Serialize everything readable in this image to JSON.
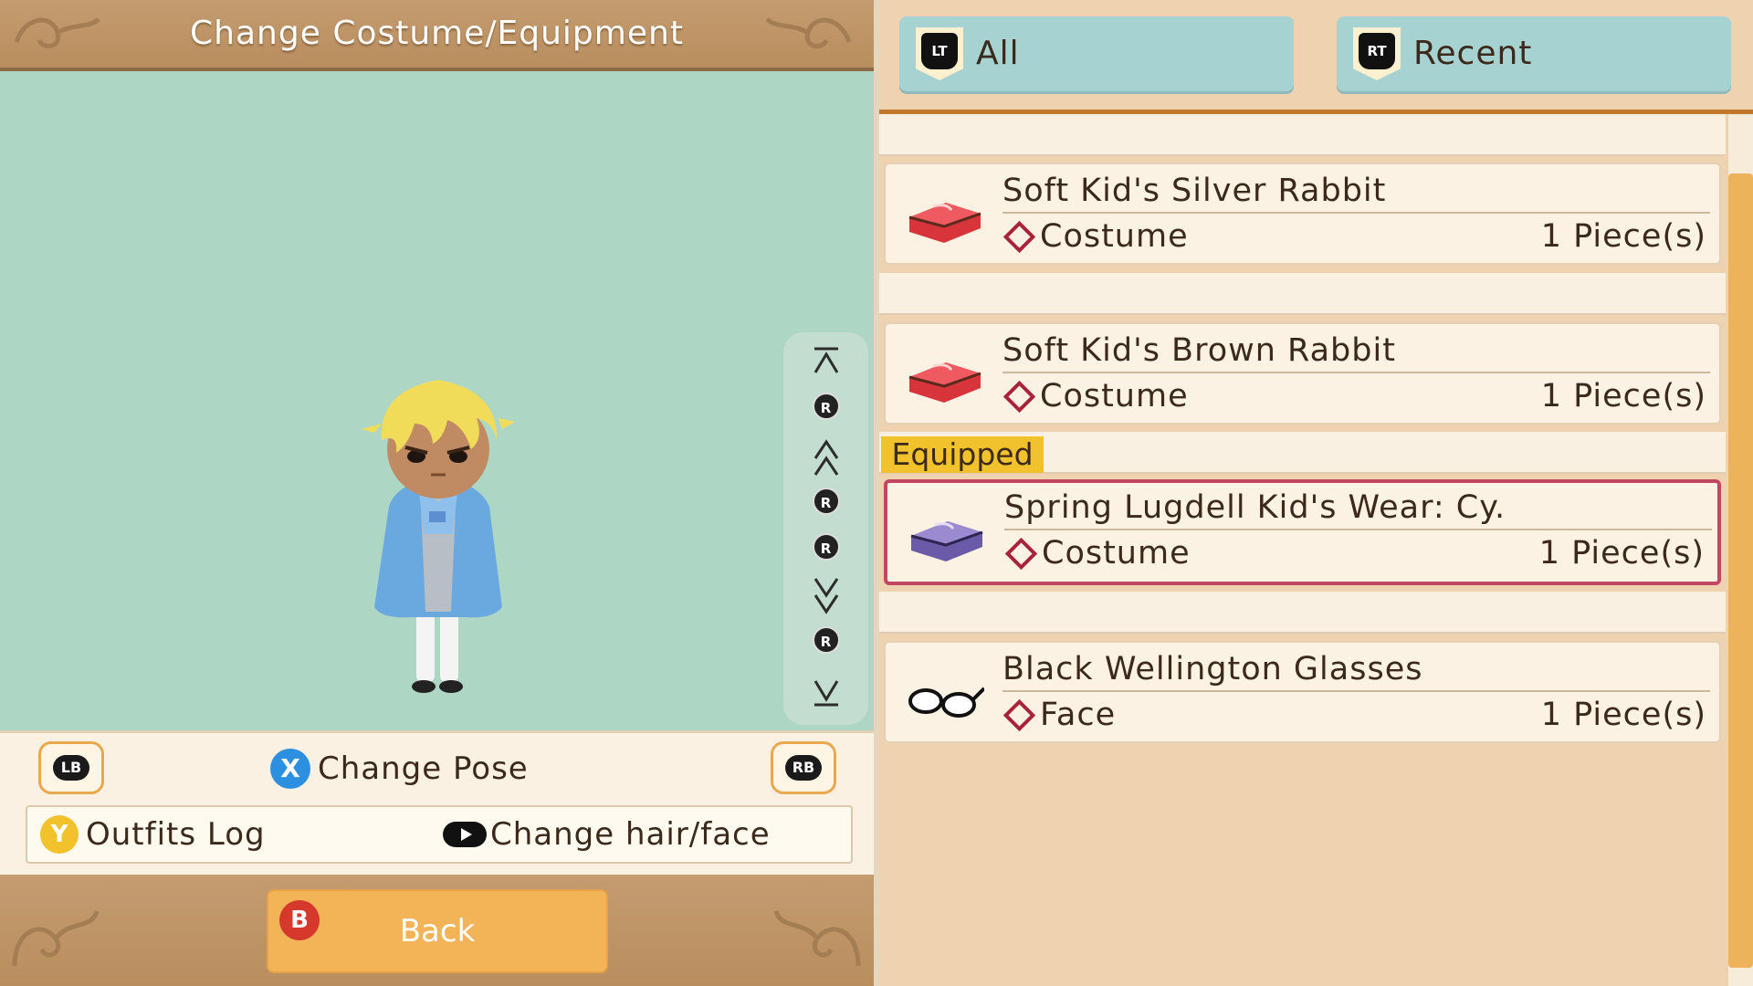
{
  "header": {
    "title": "Change Costume/Equipment"
  },
  "controls": {
    "lb": "LB",
    "rb": "RB",
    "change_pose_key": "X",
    "change_pose_label": "Change Pose",
    "outfits_log_key": "Y",
    "outfits_log_label": "Outfits Log",
    "change_hair_face_label": "Change hair/face",
    "back_key": "B",
    "back_label": "Back"
  },
  "rotation_pad": {
    "stick": "R"
  },
  "tabs": [
    {
      "key": "LT",
      "label": "All"
    },
    {
      "key": "RT",
      "label": "Recent"
    }
  ],
  "equipped_label": "Equipped",
  "items": [
    {
      "name": "Soft Kid's Silver Rabbit",
      "category": "Costume",
      "quantity": "1 Piece(s)",
      "icon": "red-trunk-icon"
    },
    {
      "name": "Soft Kid's Brown Rabbit",
      "category": "Costume",
      "quantity": "1 Piece(s)",
      "icon": "red-trunk-icon"
    },
    {
      "name": "Spring Lugdell Kid's Wear: Cy.",
      "category": "Costume",
      "quantity": "1 Piece(s)",
      "icon": "purple-trunk-icon"
    },
    {
      "name": "Black Wellington Glasses",
      "category": "Face",
      "quantity": "1 Piece(s)",
      "icon": "glasses-icon"
    }
  ],
  "colors": {
    "stage_bg": "#aed6c5",
    "tab_bg": "#a7d2d2",
    "equipped_border": "#c04860",
    "equipped_tag": "#f2c22c",
    "back_button": "#f2b457",
    "scroll_thumb": "#edb35b"
  }
}
